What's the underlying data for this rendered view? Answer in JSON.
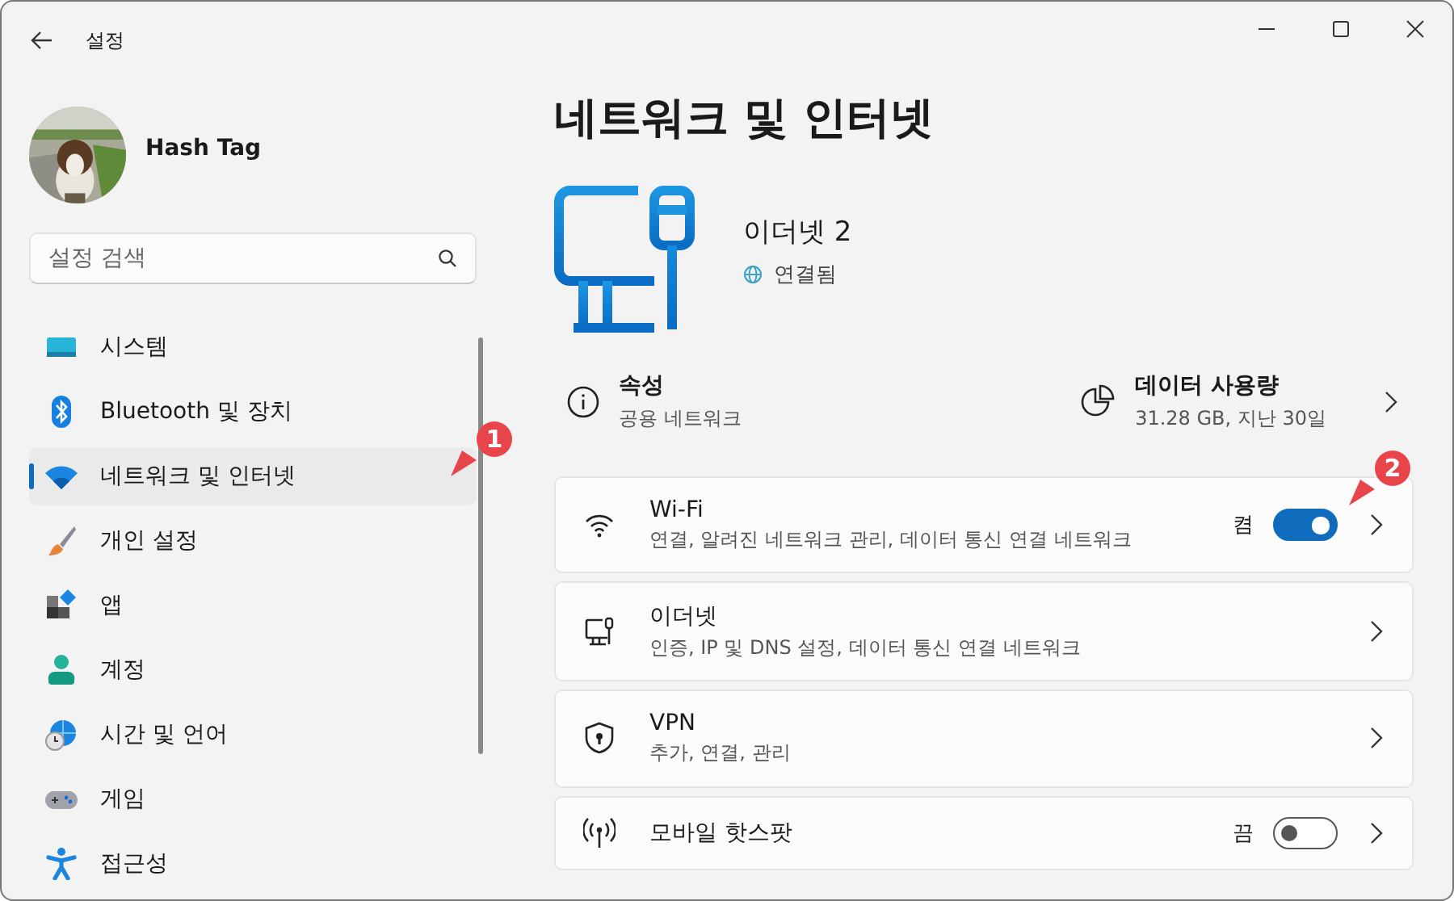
{
  "window": {
    "title": "설정"
  },
  "account": {
    "name": "Hash Tag"
  },
  "search": {
    "placeholder": "설정 검색"
  },
  "sidebar": {
    "items": [
      {
        "label": "시스템",
        "selected": false
      },
      {
        "label": "Bluetooth 및 장치",
        "selected": false
      },
      {
        "label": "네트워크 및 인터넷",
        "selected": true,
        "callout": "1"
      },
      {
        "label": "개인 설정",
        "selected": false
      },
      {
        "label": "앱",
        "selected": false
      },
      {
        "label": "계정",
        "selected": false
      },
      {
        "label": "시간 및 언어",
        "selected": false
      },
      {
        "label": "게임",
        "selected": false
      },
      {
        "label": "접근성",
        "selected": false
      }
    ]
  },
  "page": {
    "title": "네트워크 및 인터넷",
    "connection": {
      "name": "이더넷 2",
      "status": "연결됨"
    },
    "properties": {
      "title": "속성",
      "subtitle": "공용 네트워크"
    },
    "data_usage": {
      "title": "데이터 사용량",
      "subtitle": "31.28 GB, 지난 30일"
    },
    "cards": [
      {
        "title": "Wi-Fi",
        "description": "연결, 알려진 네트워크 관리, 데이터 통신 연결 네트워크",
        "toggle": {
          "label": "켬",
          "on": true
        },
        "callout": "2"
      },
      {
        "title": "이더넷",
        "description": "인증, IP 및 DNS 설정, 데이터 통신 연결 네트워크"
      },
      {
        "title": "VPN",
        "description": "추가, 연결, 관리"
      },
      {
        "title": "모바일 핫스팟",
        "toggle": {
          "label": "끔",
          "on": false
        }
      }
    ]
  }
}
